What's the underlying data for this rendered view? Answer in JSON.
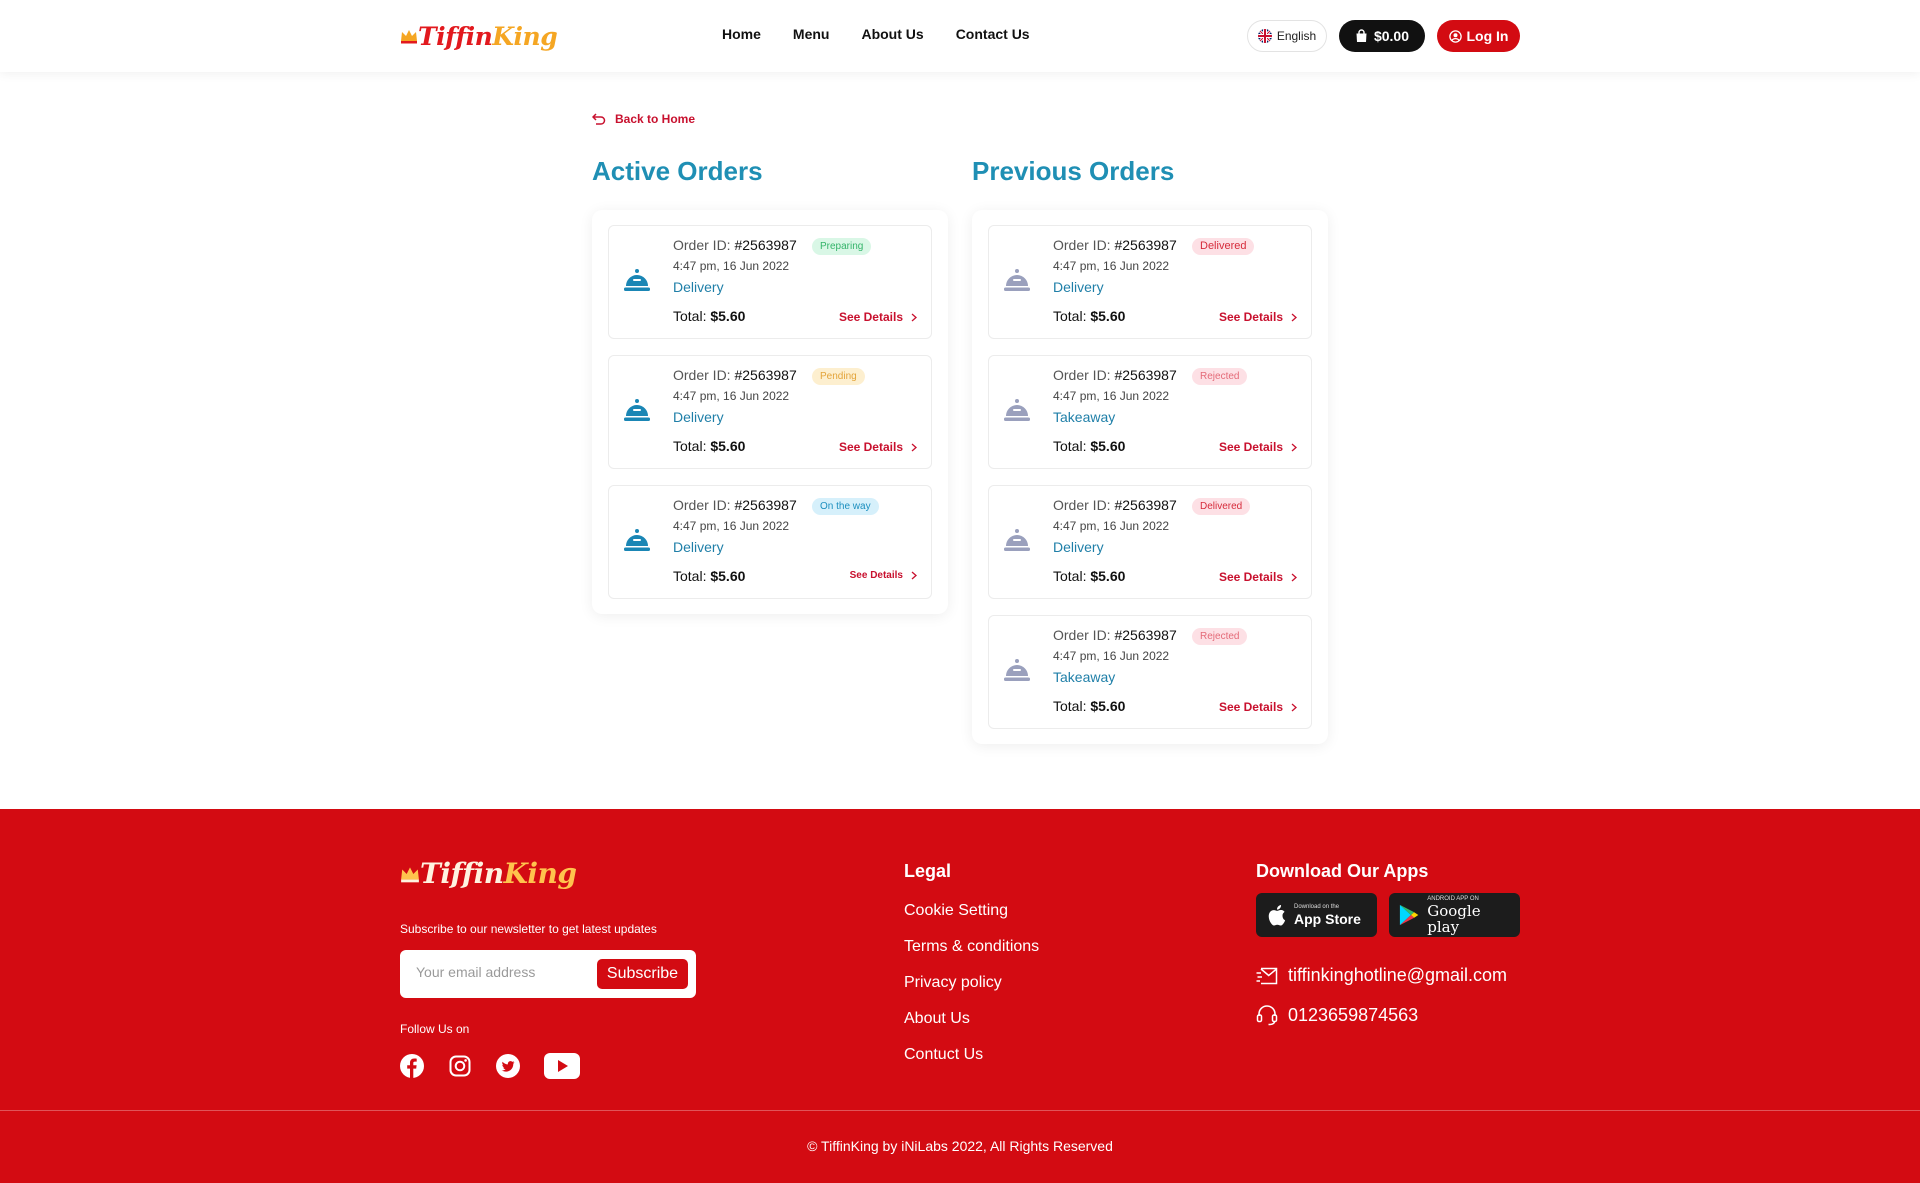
{
  "header": {
    "logo": {
      "part1": "Tiffin",
      "part2": "King"
    },
    "nav": [
      "Home",
      "Menu",
      "About Us",
      "Contact Us"
    ],
    "language": "English",
    "cart_total": "$0.00",
    "login_label": "Log In"
  },
  "back_link": "Back to Home",
  "active": {
    "title": "Active Orders",
    "orders": [
      {
        "id_label": "Order ID:",
        "id": "#2563987",
        "status": "Preparing",
        "time": "4:47 pm, 16 Jun 2022",
        "type": "Delivery",
        "total_label": "Total:",
        "total": "$5.60",
        "details_label": "See Details"
      },
      {
        "id_label": "Order ID:",
        "id": "#2563987",
        "status": "Pending",
        "time": "4:47 pm, 16 Jun 2022",
        "type": "Delivery",
        "total_label": "Total:",
        "total": "$5.60",
        "details_label": "See Details"
      },
      {
        "id_label": "Order ID:",
        "id": "#2563987",
        "status": "On the way",
        "time": "4:47 pm, 16 Jun 2022",
        "type": "Delivery",
        "total_label": "Total:",
        "total": "$5.60",
        "details_label": "See Details"
      }
    ]
  },
  "previous": {
    "title": "Previous Orders",
    "orders": [
      {
        "id_label": "Order ID:",
        "id": "#2563987",
        "status": "Delivered",
        "time": "4:47 pm, 16 Jun 2022",
        "type": "Delivery",
        "total_label": "Total:",
        "total": "$5.60",
        "details_label": "See Details"
      },
      {
        "id_label": "Order ID:",
        "id": "#2563987",
        "status": "Rejected",
        "time": "4:47 pm, 16 Jun 2022",
        "type": "Takeaway",
        "total_label": "Total:",
        "total": "$5.60",
        "details_label": "See Details"
      },
      {
        "id_label": "Order ID:",
        "id": "#2563987",
        "status": "Delivered",
        "time": "4:47 pm, 16 Jun 2022",
        "type": "Delivery",
        "total_label": "Total:",
        "total": "$5.60",
        "details_label": "See Details"
      },
      {
        "id_label": "Order ID:",
        "id": "#2563987",
        "status": "Rejected",
        "time": "4:47 pm, 16 Jun 2022",
        "type": "Takeaway",
        "total_label": "Total:",
        "total": "$5.60",
        "details_label": "See Details"
      }
    ]
  },
  "footer": {
    "newsletter_text": "Subscribe to our newsletter to get latest updates",
    "email_placeholder": "Your email address",
    "subscribe_label": "Subscribe",
    "follow_text": "Follow Us on",
    "legal_title": "Legal",
    "legal_links": [
      "Cookie Setting",
      "Terms & conditions",
      "Privacy policy",
      "About Us",
      "Contuct Us"
    ],
    "apps_title": "Download Our Apps",
    "app_store": {
      "small": "Download on the",
      "big": "App Store"
    },
    "google_play": {
      "small": "ANDROID APP ON",
      "big": "Google play"
    },
    "email": "tiffinkinghotline@gmail.com",
    "phone": "0123659874563",
    "copyright": "© TiffinKing by iNiLabs 2022, All Rights Reserved"
  },
  "colors": {
    "brand_red": "#d30b12",
    "accent_blue": "#1f8fb4",
    "active_icon": "#1a86b5",
    "previous_icon": "#9aa0bd"
  },
  "icons": {
    "order": "cloche-icon",
    "back": "undo-arrow-icon",
    "chevron": "chevron-right-icon",
    "cart": "shopping-bag-icon",
    "login": "user-circle-icon",
    "language": "uk-flag-icon",
    "email": "mail-icon",
    "phone": "headset-icon",
    "socials": [
      "facebook-icon",
      "instagram-icon",
      "twitter-icon",
      "youtube-icon"
    ]
  }
}
